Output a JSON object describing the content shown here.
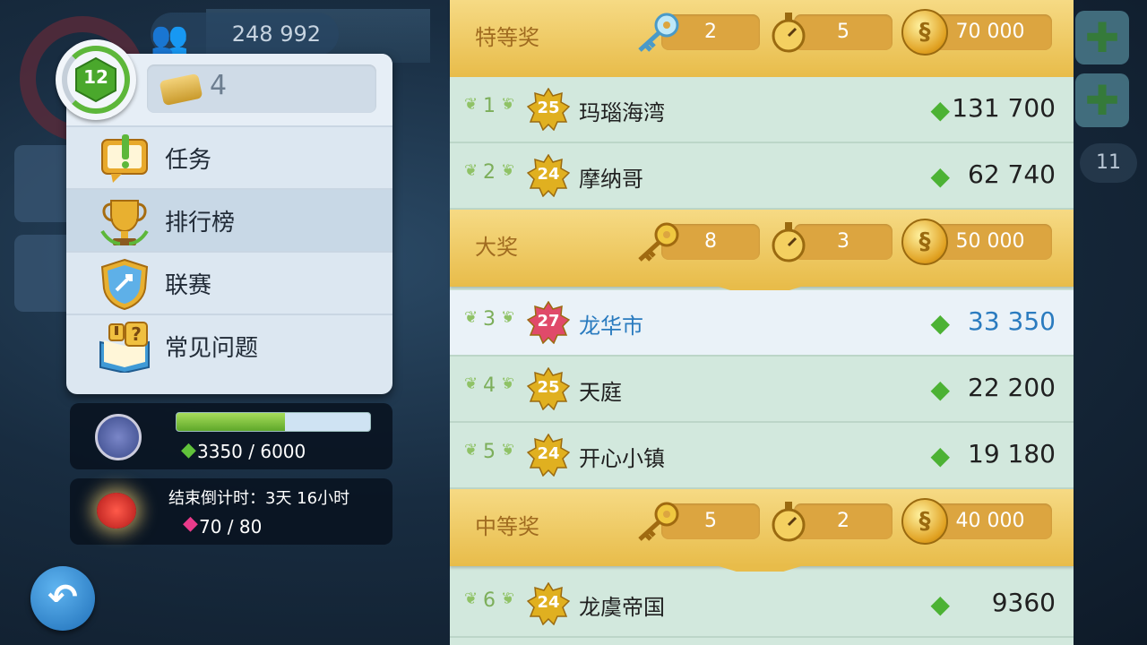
{
  "hud": {
    "population": "248 992",
    "right_badge": "11",
    "plus": "✚"
  },
  "menu": {
    "level": "12",
    "tokens": "4",
    "items": [
      {
        "label": "任务"
      },
      {
        "label": "排行榜"
      },
      {
        "label": "联赛"
      },
      {
        "label": "常见问题"
      }
    ]
  },
  "league": {
    "progress_text": "3350 / 6000",
    "progress_fraction": 0.56
  },
  "event": {
    "countdown": "结束倒计时：3天 16小时",
    "progress_text": "70 / 80"
  },
  "leaderboard": {
    "tiers": [
      {
        "name": "特等奖",
        "keys": "2",
        "time": "5",
        "coins": "70 000"
      },
      {
        "name": "大奖",
        "keys": "8",
        "time": "3",
        "coins": "50 000"
      },
      {
        "name": "中等奖",
        "keys": "5",
        "time": "2",
        "coins": "40 000"
      }
    ],
    "rows": [
      {
        "rank": "1",
        "level": "25",
        "name": "玛瑙海湾",
        "score": "131 700"
      },
      {
        "rank": "2",
        "level": "24",
        "name": "摩纳哥",
        "score": "62 740"
      },
      {
        "rank": "3",
        "level": "27",
        "name": "龙华市",
        "score": "33 350"
      },
      {
        "rank": "4",
        "level": "25",
        "name": "天庭",
        "score": "22 200"
      },
      {
        "rank": "5",
        "level": "24",
        "name": "开心小镇",
        "score": "19 180"
      },
      {
        "rank": "6",
        "level": "24",
        "name": "龙虞帝国",
        "score": "9360"
      }
    ]
  },
  "colors": {
    "tier_gold": "#e8bc4a",
    "row_green": "#d2e8dd",
    "highlight_blue": "#2a7bbf"
  }
}
